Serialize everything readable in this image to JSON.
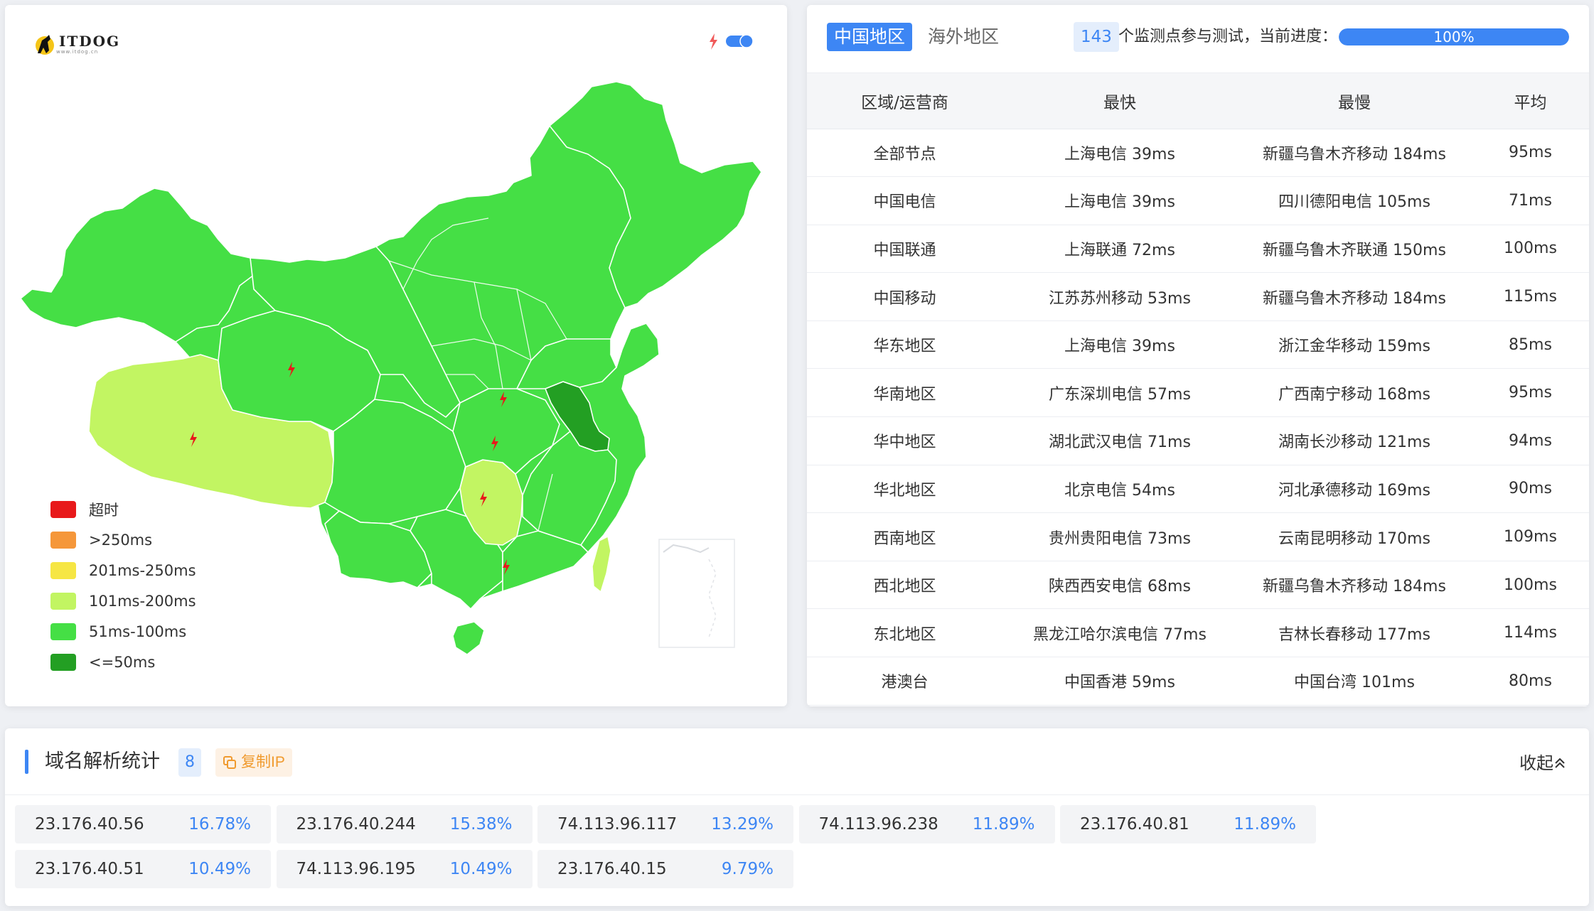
{
  "map": {
    "logo_text": "ITDOG",
    "logo_sub": "www.itdog.cn",
    "toggle_on": true,
    "legend": [
      {
        "label": "超时",
        "color": "#e8191b"
      },
      {
        "label": ">250ms",
        "color": "#f5973a"
      },
      {
        "label": "201ms-250ms",
        "color": "#f6e644"
      },
      {
        "label": "101ms-200ms",
        "color": "#c2f562"
      },
      {
        "label": "51ms-100ms",
        "color": "#45df45"
      },
      {
        "label": "<=50ms",
        "color": "#239f23"
      }
    ]
  },
  "stats": {
    "tabs": [
      {
        "label": "中国地区",
        "active": true
      },
      {
        "label": "海外地区",
        "active": false
      }
    ],
    "node_count": "143",
    "node_text": "个监测点参与测试，当前进度：",
    "progress_label": "100%",
    "progress_value": 1.0,
    "columns": [
      "区域/运营商",
      "最快",
      "最慢",
      "平均"
    ],
    "rows": [
      [
        "全部节点",
        "上海电信 39ms",
        "新疆乌鲁木齐移动 184ms",
        "95ms"
      ],
      [
        "中国电信",
        "上海电信 39ms",
        "四川德阳电信 105ms",
        "71ms"
      ],
      [
        "中国联通",
        "上海联通 72ms",
        "新疆乌鲁木齐联通 150ms",
        "100ms"
      ],
      [
        "中国移动",
        "江苏苏州移动 53ms",
        "新疆乌鲁木齐移动 184ms",
        "115ms"
      ],
      [
        "华东地区",
        "上海电信 39ms",
        "浙江金华移动 159ms",
        "85ms"
      ],
      [
        "华南地区",
        "广东深圳电信 57ms",
        "广西南宁移动 168ms",
        "95ms"
      ],
      [
        "华中地区",
        "湖北武汉电信 71ms",
        "湖南长沙移动 121ms",
        "94ms"
      ],
      [
        "华北地区",
        "北京电信 54ms",
        "河北承德移动 169ms",
        "90ms"
      ],
      [
        "西南地区",
        "贵州贵阳电信 73ms",
        "云南昆明移动 170ms",
        "109ms"
      ],
      [
        "西北地区",
        "陕西西安电信 68ms",
        "新疆乌鲁木齐移动 184ms",
        "100ms"
      ],
      [
        "东北地区",
        "黑龙江哈尔滨电信 77ms",
        "吉林长春移动 177ms",
        "114ms"
      ],
      [
        "港澳台",
        "中国香港 59ms",
        "中国台湾 101ms",
        "80ms"
      ]
    ]
  },
  "dns": {
    "title": "域名解析统计",
    "count": "8",
    "copy_label": "复制IP",
    "collapse_label": "收起",
    "ips": [
      {
        "ip": "23.176.40.56",
        "pct": "16.78%"
      },
      {
        "ip": "23.176.40.244",
        "pct": "15.38%"
      },
      {
        "ip": "74.113.96.117",
        "pct": "13.29%"
      },
      {
        "ip": "74.113.96.238",
        "pct": "11.89%"
      },
      {
        "ip": "23.176.40.81",
        "pct": "11.89%"
      },
      {
        "ip": "23.176.40.51",
        "pct": "10.49%"
      },
      {
        "ip": "74.113.96.195",
        "pct": "10.49%"
      },
      {
        "ip": "23.176.40.15",
        "pct": "9.79%"
      }
    ]
  }
}
